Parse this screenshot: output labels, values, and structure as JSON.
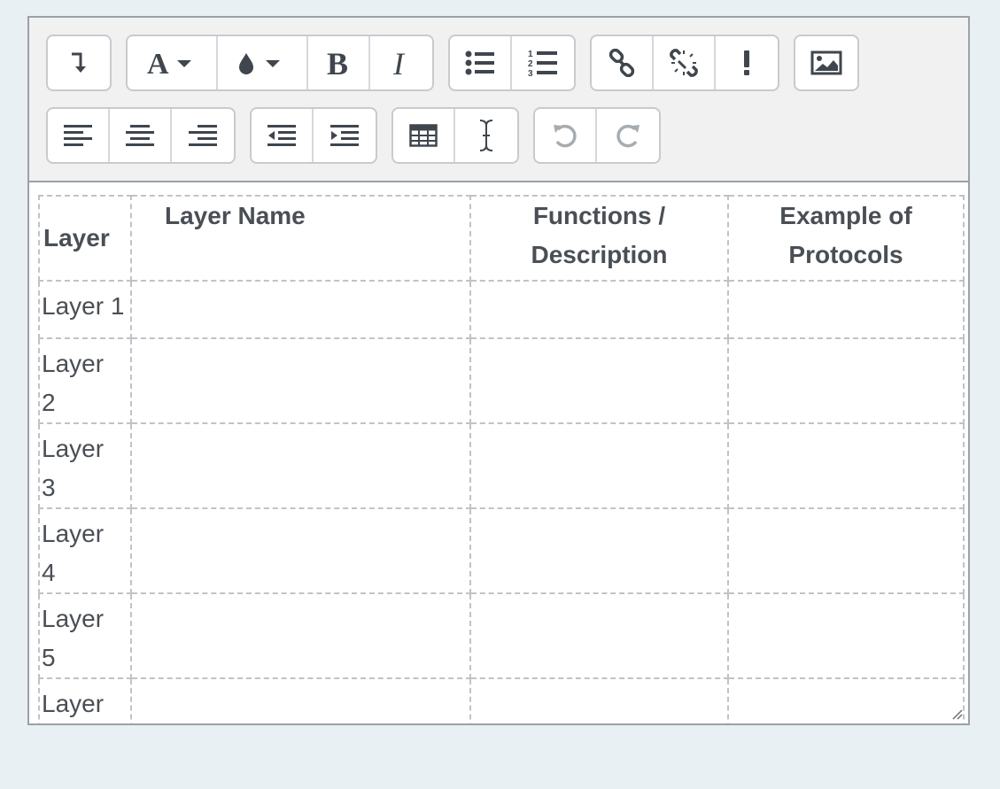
{
  "toolbar": {
    "row1": [
      {
        "name": "show-more-buttons",
        "icon": "arrow-down-turn-icon"
      },
      {
        "name": "font-style",
        "icon": "font-a-dropdown-icon"
      },
      {
        "name": "font-color",
        "icon": "drop-dropdown-icon"
      },
      {
        "name": "bold",
        "icon": "bold-b-icon"
      },
      {
        "name": "italic",
        "icon": "italic-i-icon"
      },
      {
        "name": "unordered-list",
        "icon": "bullet-list-icon"
      },
      {
        "name": "ordered-list",
        "icon": "numbered-list-icon"
      },
      {
        "name": "link",
        "icon": "link-icon"
      },
      {
        "name": "unlink",
        "icon": "unlink-icon"
      },
      {
        "name": "accessibility-checker",
        "icon": "exclamation-icon"
      },
      {
        "name": "insert-image",
        "icon": "image-icon"
      }
    ],
    "row2": [
      {
        "name": "align-left",
        "icon": "align-left-icon"
      },
      {
        "name": "align-center",
        "icon": "align-center-icon"
      },
      {
        "name": "align-right",
        "icon": "align-right-icon"
      },
      {
        "name": "outdent",
        "icon": "outdent-icon"
      },
      {
        "name": "indent",
        "icon": "indent-icon"
      },
      {
        "name": "table",
        "icon": "table-icon"
      },
      {
        "name": "text-cursor",
        "icon": "text-cursor-icon"
      },
      {
        "name": "undo",
        "icon": "undo-icon",
        "disabled": true
      },
      {
        "name": "redo",
        "icon": "redo-icon",
        "disabled": true
      }
    ]
  },
  "table": {
    "headers": {
      "layer": "Layer",
      "layer_name": "Layer Name",
      "functions": "Functions  /\nDescription",
      "examples": "Example of\nProtocols"
    },
    "rows": [
      {
        "layer": "Layer 1",
        "name": "",
        "functions": "",
        "examples": ""
      },
      {
        "layer": "Layer\n2",
        "name": "",
        "functions": "",
        "examples": ""
      },
      {
        "layer": "Layer\n3",
        "name": "",
        "functions": "",
        "examples": ""
      },
      {
        "layer": "Layer\n4",
        "name": "",
        "functions": "",
        "examples": ""
      },
      {
        "layer": "Layer\n5",
        "name": "",
        "functions": "",
        "examples": ""
      },
      {
        "layer": "Layer",
        "name": "",
        "functions": "",
        "examples": ""
      }
    ]
  },
  "colors": {
    "icon": "#3f464d",
    "icon_disabled": "#a7acb1",
    "toolbar_bg": "#f1f1f1",
    "page_bg": "#e8f0f3",
    "text": "#4a4f55"
  }
}
